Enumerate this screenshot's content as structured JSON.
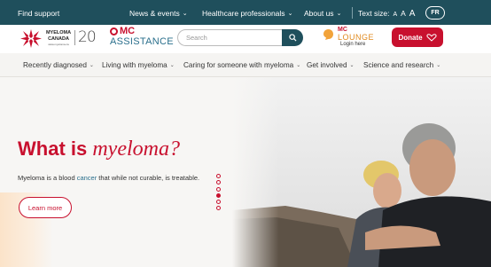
{
  "topbar": {
    "find_support": "Find support",
    "nav": [
      {
        "label": "News & events"
      },
      {
        "label": "Healthcare professionals"
      },
      {
        "label": "About us"
      }
    ],
    "text_size_label": "Text size:",
    "text_sizes": [
      "A",
      "A",
      "A"
    ],
    "lang": "FR"
  },
  "header": {
    "logo_line1": "MYELOMA",
    "logo_line2": "CANADA",
    "logo_small": "www.myeloma.ca",
    "anniversary": "20",
    "mc_assistance_top": "MC",
    "mc_assistance_sub": "ASSISTANCE",
    "search_placeholder": "Search",
    "lounge_mc": "MC",
    "lounge_name": "LOUNGE",
    "lounge_login": "Login here",
    "donate": "Donate"
  },
  "mainnav": [
    {
      "label": "Recently diagnosed"
    },
    {
      "label": "Living with myeloma"
    },
    {
      "label": "Caring for someone with myeloma"
    },
    {
      "label": "Get involved"
    },
    {
      "label": "Science and research"
    }
  ],
  "hero": {
    "title_plain": "What is ",
    "title_italic": "myeloma?",
    "desc_before": "Myeloma is a blood ",
    "desc_link": "cancer",
    "desc_after": " that while not curable, is treatable.",
    "cta": "Learn more",
    "slides_total": 6,
    "slide_active": 4
  },
  "colors": {
    "brand_red": "#c8102e",
    "topbar_teal": "#1f4f5c",
    "accent_blue": "#2a6f8c"
  }
}
